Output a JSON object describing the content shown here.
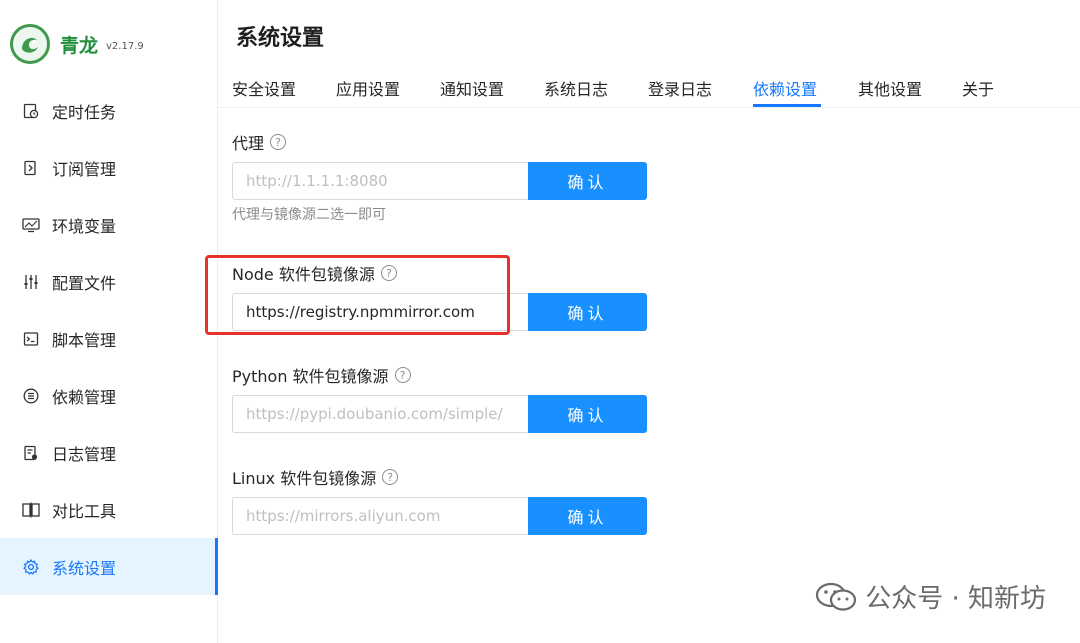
{
  "brand": {
    "name": "青龙",
    "version": "v2.17.9"
  },
  "sidebar": {
    "items": [
      {
        "label": "定时任务",
        "icon": "clock-task-icon"
      },
      {
        "label": "订阅管理",
        "icon": "subscription-icon"
      },
      {
        "label": "环境变量",
        "icon": "monitor-icon"
      },
      {
        "label": "配置文件",
        "icon": "sliders-icon"
      },
      {
        "label": "脚本管理",
        "icon": "terminal-icon"
      },
      {
        "label": "依赖管理",
        "icon": "list-circle-icon"
      },
      {
        "label": "日志管理",
        "icon": "log-file-icon"
      },
      {
        "label": "对比工具",
        "icon": "diff-icon"
      },
      {
        "label": "系统设置",
        "icon": "gear-icon",
        "active": true
      }
    ]
  },
  "page": {
    "title": "系统设置"
  },
  "tabs": [
    {
      "label": "安全设置"
    },
    {
      "label": "应用设置"
    },
    {
      "label": "通知设置"
    },
    {
      "label": "系统日志"
    },
    {
      "label": "登录日志"
    },
    {
      "label": "依赖设置",
      "active": true
    },
    {
      "label": "其他设置"
    },
    {
      "label": "关于"
    }
  ],
  "form": {
    "proxy": {
      "label": "代理",
      "value": "",
      "placeholder": "http://1.1.1.1:8080",
      "hint": "代理与镜像源二选一即可"
    },
    "node": {
      "label": "Node 软件包镜像源",
      "value": "https://registry.npmmirror.com",
      "placeholder": ""
    },
    "python": {
      "label": "Python 软件包镜像源",
      "value": "",
      "placeholder": "https://pypi.doubanio.com/simple/"
    },
    "linux": {
      "label": "Linux 软件包镜像源",
      "value": "",
      "placeholder": "https://mirrors.aliyun.com"
    },
    "confirm_label": "确认",
    "help_glyph": "?"
  },
  "watermark": {
    "text": "公众号 · 知新坊"
  },
  "colors": {
    "primary": "#1890ff",
    "active_text": "#1677ff",
    "highlight": "#e8312a",
    "brand": "#1f8f3c"
  }
}
